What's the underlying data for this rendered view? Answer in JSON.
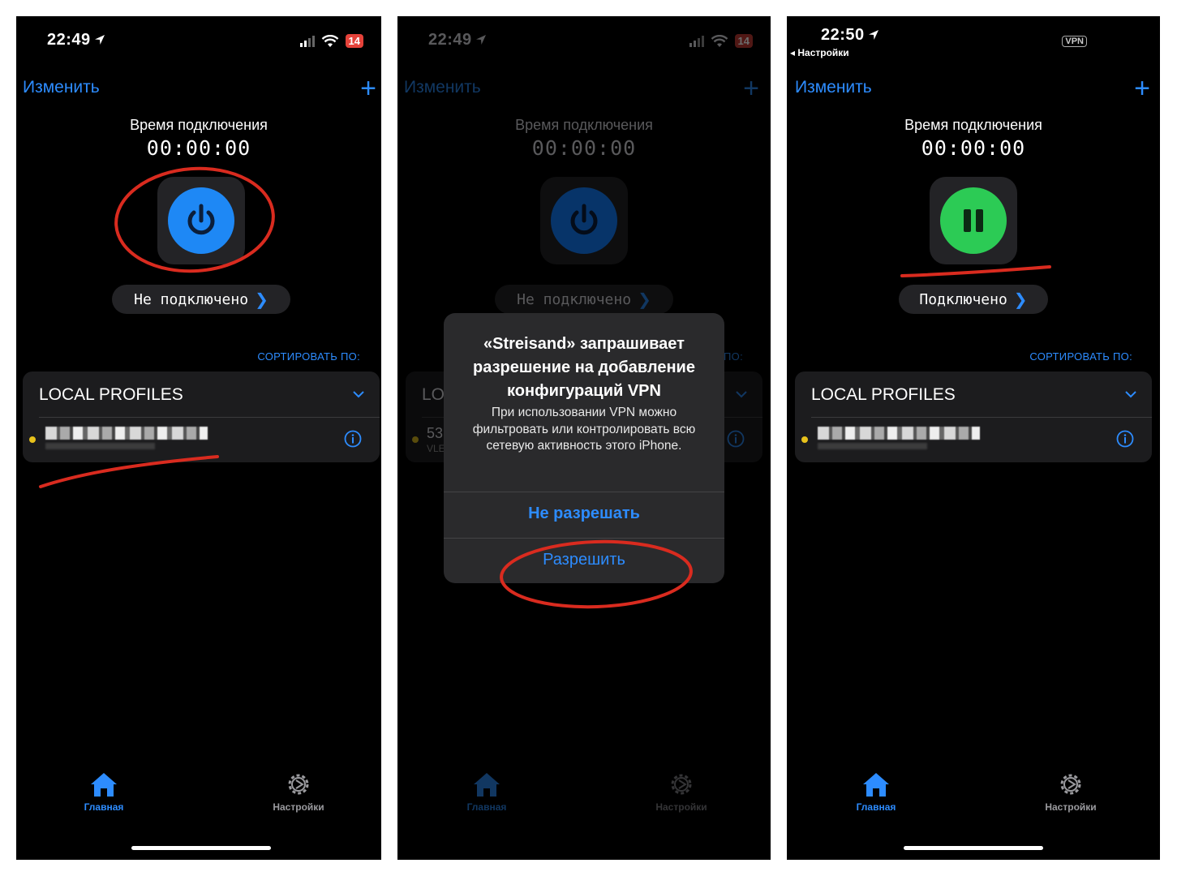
{
  "screens": [
    {
      "status": {
        "time": "22:49",
        "battery": "14"
      },
      "nav": {
        "edit": "Изменить",
        "add": "+"
      },
      "connection_label": "Время подключения",
      "timer": "00:00:00",
      "status_pill": "Не  подключено",
      "sort_label": "СОРТИРОВАТЬ ПО:",
      "profiles_title": "LOCAL PROFILES",
      "tabs": {
        "home": "Главная",
        "settings": "Настройки"
      }
    },
    {
      "status": {
        "time": "22:49",
        "battery": "14"
      },
      "nav": {
        "edit": "Изменить",
        "add": "+"
      },
      "connection_label": "Время подключения",
      "timer": "00:00:00",
      "status_pill": "Не  подключено",
      "sort_label": "ПО:",
      "profiles_title": "LO",
      "profile_partial": "53",
      "profile_sub_partial": "VLE",
      "tabs": {
        "home": "Главная",
        "settings": "Настройки"
      },
      "alert": {
        "title": "«Streisand» запрашивает разрешение на добавление конфигураций VPN",
        "message": "При использовании VPN можно фильтровать или контролировать всю сетевую активность этого iPhone.",
        "deny": "Не разрешать",
        "allow": "Разрешить"
      }
    },
    {
      "status": {
        "time": "22:50",
        "back": "◂ Настройки",
        "vpn": "VPN"
      },
      "nav": {
        "edit": "Изменить",
        "add": "+"
      },
      "connection_label": "Время подключения",
      "timer": "00:00:00",
      "status_pill": "Подключено",
      "sort_label": "СОРТИРОВАТЬ ПО:",
      "profiles_title": "LOCAL PROFILES",
      "tabs": {
        "home": "Главная",
        "settings": "Настройки"
      }
    }
  ],
  "colors": {
    "accent": "#2d8cff",
    "power_idle": "#1e88f5",
    "power_connecting": "#0d5bb5",
    "connected": "#2ccb55",
    "annotation": "#d92b1f",
    "profile_dot": "#e8c21b"
  }
}
